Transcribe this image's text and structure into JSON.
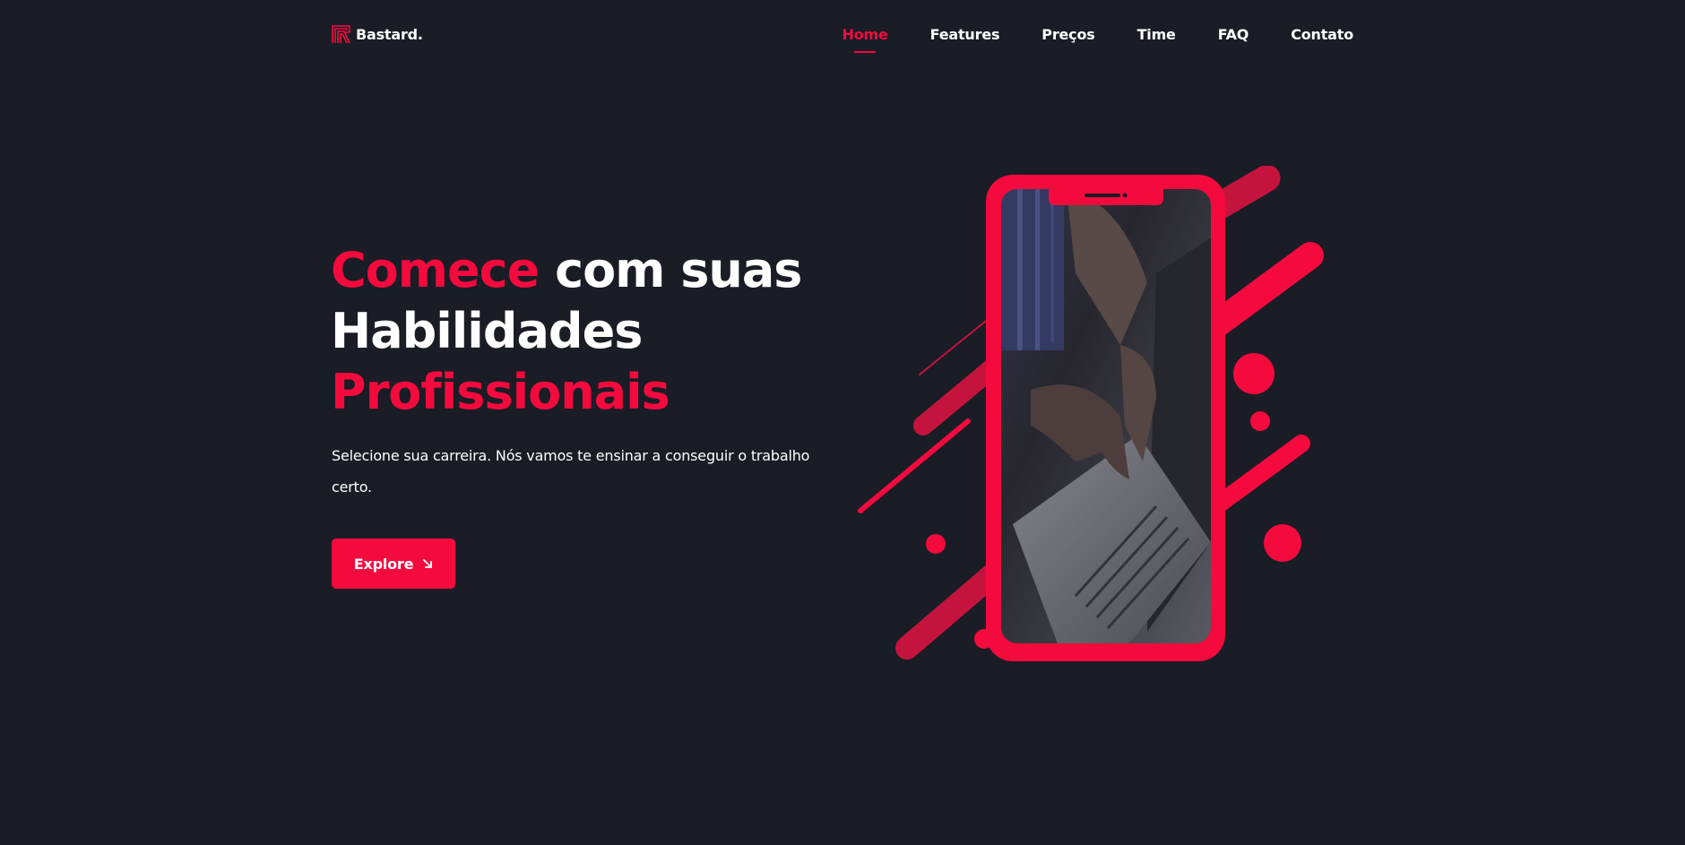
{
  "brand": {
    "name": "Bastard.",
    "accent_color": "#f50a3e",
    "background_color": "#1a1c26"
  },
  "nav": {
    "items": [
      {
        "label": "Home",
        "active": true
      },
      {
        "label": "Features",
        "active": false
      },
      {
        "label": "Preços",
        "active": false
      },
      {
        "label": "Time",
        "active": false
      },
      {
        "label": "FAQ",
        "active": false
      },
      {
        "label": "Contato",
        "active": false
      }
    ]
  },
  "hero": {
    "title_part1": "Comece",
    "title_part2": " com suas",
    "title_line2": "Habilidades",
    "title_line3": "Profissionais",
    "subtitle": "Selecione sua carreira. Nós vamos te ensinar a conseguir o trabalho certo.",
    "button_label": "Explore",
    "button_icon": "arrow-down-right-icon"
  },
  "illustration": {
    "icon": "phone-mockup-illustration",
    "photo": "hands-typing-on-laptop-photo"
  }
}
